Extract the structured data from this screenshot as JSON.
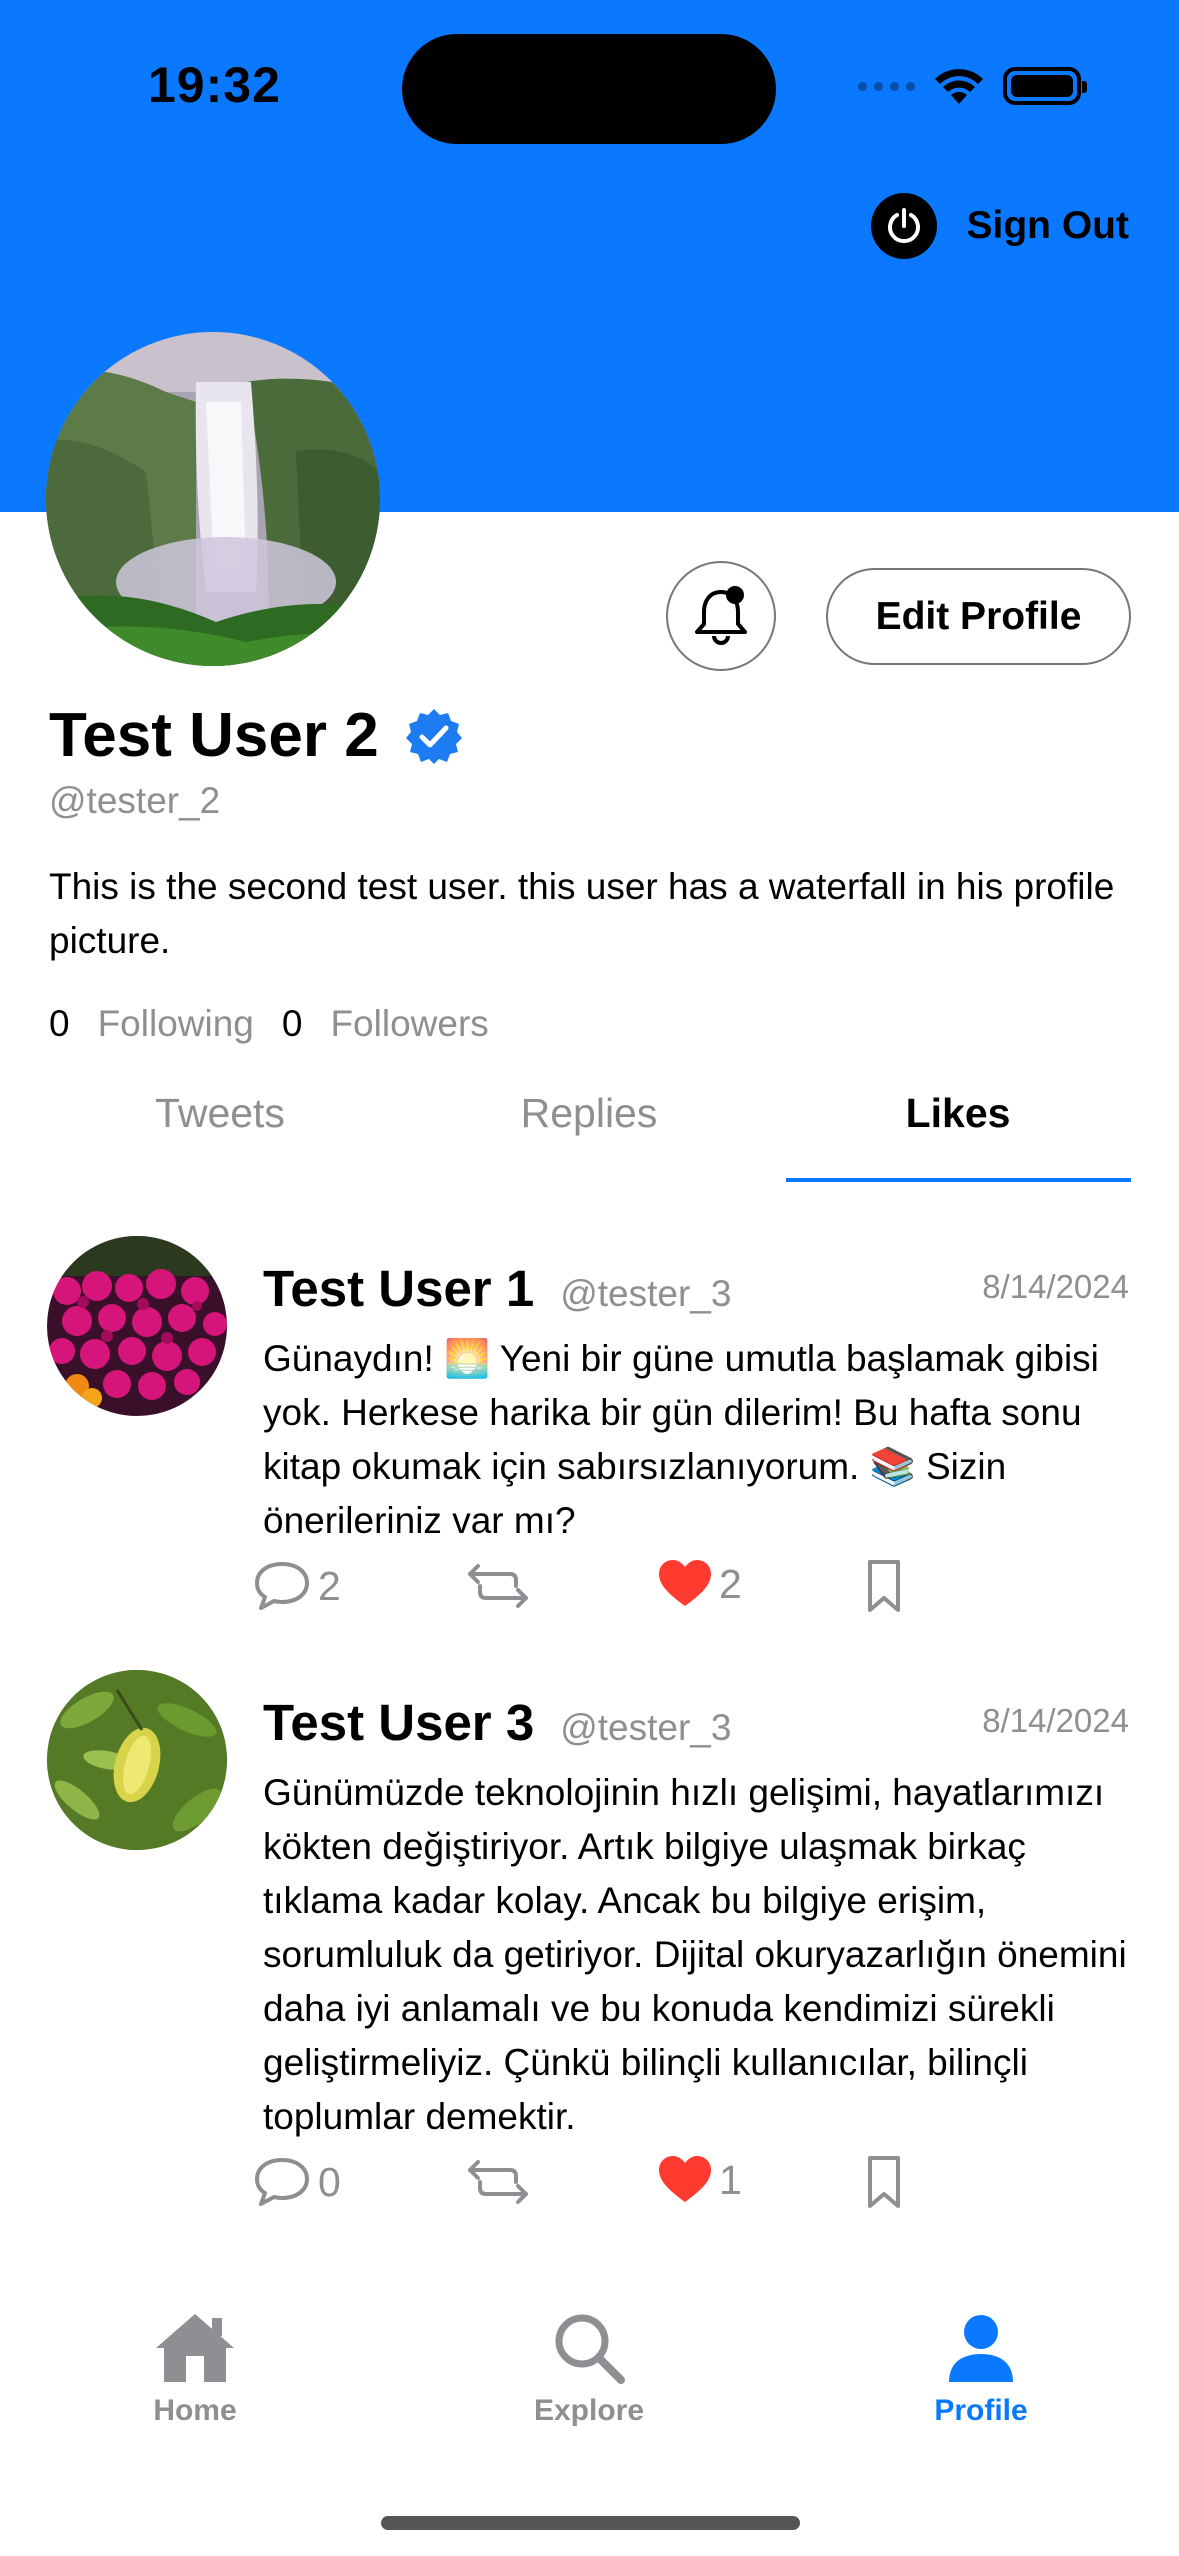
{
  "status_bar": {
    "time": "19:32"
  },
  "header": {
    "sign_out_label": "Sign Out"
  },
  "profile": {
    "display_name": "Test User 2",
    "handle": "@tester_2",
    "bio": "This is the second test user. this user has a waterfall in his profile picture.",
    "following_count": "0",
    "following_label": "Following",
    "followers_count": "0",
    "followers_label": "Followers",
    "edit_label": "Edit Profile"
  },
  "tabs": [
    {
      "label": "Tweets"
    },
    {
      "label": "Replies"
    },
    {
      "label": "Likes"
    }
  ],
  "active_tab": "Likes",
  "tweets": [
    {
      "name": "Test User 1",
      "handle": "@tester_3",
      "date": "8/14/2024",
      "text": "Günaydın! 🌅 Yeni bir güne umutla başlamak gibisi yok. Herkese harika bir gün dilerim! Bu hafta sonu kitap okumak için sabırsızlanıyorum. 📚 Sizin önerileriniz var mı?",
      "replies": "2",
      "likes": "2"
    },
    {
      "name": "Test User 3",
      "handle": "@tester_3",
      "date": "8/14/2024",
      "text": "Günümüzde teknolojinin hızlı gelişimi, hayatlarımızı kökten değiştiriyor. Artık bilgiye ulaşmak birkaç tıklama kadar kolay. Ancak bu bilgiye erişim, sorumluluk da getiriyor. Dijital okuryazarlığın önemini daha iyi anlamalı ve bu konuda kendimizi sürekli geliştirmeliyiz. Çünkü bilinçli kullanıcılar, bilinçli toplumlar demektir.",
      "replies": "0",
      "likes": "1"
    }
  ],
  "tabbar": [
    {
      "label": "Home",
      "icon": "house-icon"
    },
    {
      "label": "Explore",
      "icon": "magnifier-icon"
    },
    {
      "label": "Profile",
      "icon": "person-icon"
    }
  ],
  "colors": {
    "accent": "#0a78ff",
    "like": "#ff3b30",
    "secondary_text": "#8e8e93"
  }
}
